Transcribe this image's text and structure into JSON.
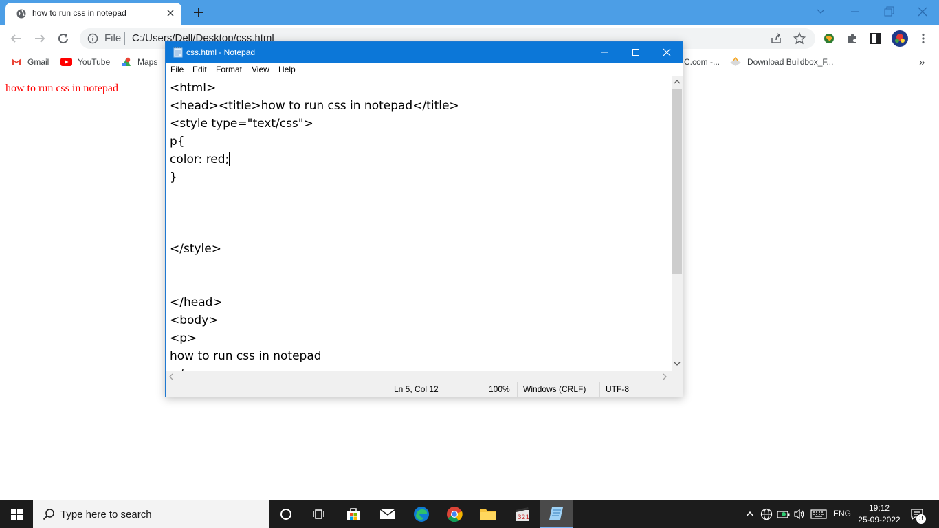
{
  "browser": {
    "tab_title": "how to run css in notepad",
    "address_scheme": "File",
    "address_url": "C:/Users/Dell/Desktop/css.html",
    "bookmarks": [
      {
        "label": "Gmail",
        "icon": "gmail-icon"
      },
      {
        "label": "YouTube",
        "icon": "youtube-icon"
      },
      {
        "label": "Maps",
        "icon": "maps-icon"
      },
      {
        "label": "C.com -...",
        "icon": "bookmark-icon"
      },
      {
        "label": "Download Buildbox_F...",
        "icon": "buildbox-icon"
      }
    ],
    "more_bookmarks": "»"
  },
  "page": {
    "paragraph": "how to run css in notepad",
    "paragraph_color": "#ff0000"
  },
  "notepad": {
    "title": "css.html - Notepad",
    "menu": [
      "File",
      "Edit",
      "Format",
      "View",
      "Help"
    ],
    "lines": [
      "<html>",
      "<head><title>how to run css in notepad</title>",
      "<style type=\"text/css\">",
      "p{",
      "color: red;",
      "}",
      "",
      "",
      "",
      "</style>",
      "",
      "",
      "</head>",
      "<body>",
      "<p>",
      "how to run css in notepad",
      "</p>"
    ],
    "status": {
      "position": "Ln 5, Col 12",
      "zoom": "100%",
      "line_ending": "Windows (CRLF)",
      "encoding": "UTF-8"
    }
  },
  "taskbar": {
    "search_placeholder": "Type here to search",
    "apps": [
      "cortana-icon",
      "task-view-icon",
      "store-icon",
      "mail-icon",
      "edge-icon",
      "chrome-icon",
      "file-explorer-icon",
      "video-editor-icon",
      "notepad-icon"
    ],
    "language": "ENG",
    "time": "19:12",
    "date": "25-09-2022",
    "notification_count": "3"
  },
  "colors": {
    "chrome_frame": "#4c9ee6",
    "notepad_titlebar": "#0c77d8",
    "taskbar": "#1c1c1c"
  }
}
